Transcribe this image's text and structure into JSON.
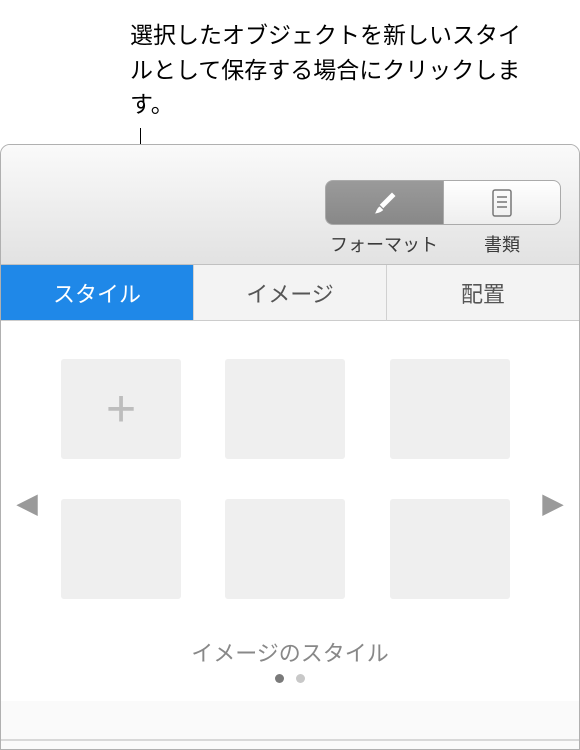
{
  "annotation": {
    "text": "選択したオブジェクトを新しいスタイルとして保存する場合にクリックします。"
  },
  "toolbar": {
    "format": {
      "label": "フォーマット"
    },
    "document": {
      "label": "書類"
    }
  },
  "tabs": {
    "style": "スタイル",
    "image": "イメージ",
    "arrange": "配置",
    "active": "style"
  },
  "styles": {
    "section_title": "イメージのスタイル",
    "pages": {
      "current": 1,
      "total": 2
    }
  }
}
